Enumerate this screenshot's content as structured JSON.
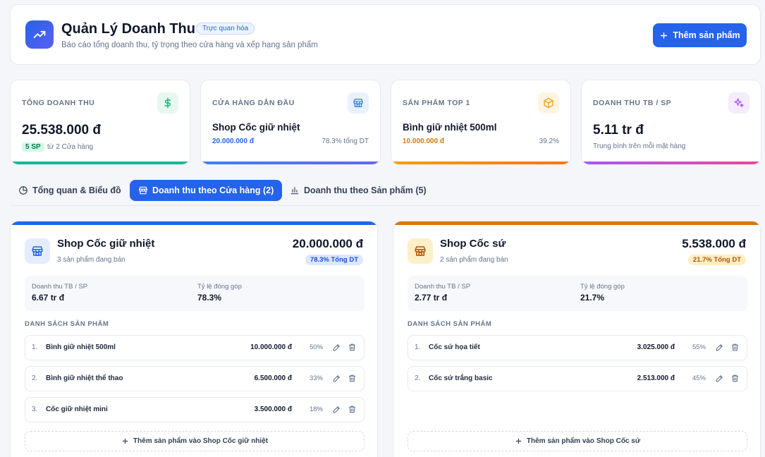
{
  "header": {
    "title": "Quản Lý Doanh Thu",
    "badge": "Trực quan hóa",
    "subtitle": "Báo cáo tổng doanh thu, tỷ trọng theo cửa hàng và xếp hạng sản phẩm",
    "add_button": "Thêm sản phẩm"
  },
  "stats": {
    "total": {
      "label": "TỔNG DOANH THU",
      "value": "25.538.000 đ",
      "chip": "5 SP",
      "note": "từ 2 Cửa hàng",
      "icon": "dollar-icon",
      "color": "#10b981"
    },
    "top_shop": {
      "label": "CỬA HÀNG DẪN ĐẦU",
      "name": "Shop Cốc giữ nhiệt",
      "value": "20.000.000 đ",
      "share": "78.3% tổng DT",
      "icon": "store-icon",
      "color": "#3b82f6"
    },
    "top_product": {
      "label": "SẢN PHẨM TOP 1",
      "name": "Bình giữ nhiệt 500ml",
      "value": "10.000.000 đ",
      "share": "39.2%",
      "icon": "box-icon",
      "color": "#f59e0b"
    },
    "avg": {
      "label": "DOANH THU TB / SP",
      "value": "5.11 tr đ",
      "note": "Trung bình trên mỗi mặt hàng",
      "icon": "sparkle-icon",
      "color": "#a855f7"
    }
  },
  "tabs": [
    {
      "label": "Tổng quan & Biểu đồ",
      "icon": "pie-chart-icon"
    },
    {
      "label": "Doanh thu theo Cửa hàng (2)",
      "icon": "store-icon"
    },
    {
      "label": "Doanh thu theo Sản phẩm (5)",
      "icon": "bar-chart-icon"
    }
  ],
  "shops": [
    {
      "name": "Shop Cốc giữ nhiệt",
      "count": "3 sản phẩm đang bán",
      "total": "20.000.000 đ",
      "percent": "78.3% Tổng DT",
      "avg_label": "Doanh thu TB / SP",
      "avg_value": "6.67 tr đ",
      "share_label": "Tỷ lệ đóng góp",
      "share_value": "78.3%",
      "list_label": "DANH SÁCH SẢN PHẨM",
      "products": [
        {
          "idx": "1.",
          "name": "Bình giữ nhiệt 500ml",
          "value": "10.000.000 đ",
          "pct": "50%"
        },
        {
          "idx": "2.",
          "name": "Bình giữ nhiệt thể thao",
          "value": "6.500.000 đ",
          "pct": "33%"
        },
        {
          "idx": "3.",
          "name": "Cốc giữ nhiệt mini",
          "value": "3.500.000 đ",
          "pct": "18%"
        }
      ],
      "add_label": "Thêm sản phẩm vào Shop Cốc giữ nhiệt",
      "accent": "#2563eb"
    },
    {
      "name": "Shop Cốc sứ",
      "count": "2 sản phẩm đang bán",
      "total": "5.538.000 đ",
      "percent": "21.7% Tổng DT",
      "avg_label": "Doanh thu TB / SP",
      "avg_value": "2.77 tr đ",
      "share_label": "Tỷ lệ đóng góp",
      "share_value": "21.7%",
      "list_label": "DANH SÁCH SẢN PHẨM",
      "products": [
        {
          "idx": "1.",
          "name": "Cốc sứ họa tiết",
          "value": "3.025.000 đ",
          "pct": "55%"
        },
        {
          "idx": "2.",
          "name": "Cốc sứ trắng basic",
          "value": "2.513.000 đ",
          "pct": "45%"
        }
      ],
      "add_label": "Thêm sản phẩm vào Shop Cốc sứ",
      "accent": "#d97706"
    }
  ]
}
